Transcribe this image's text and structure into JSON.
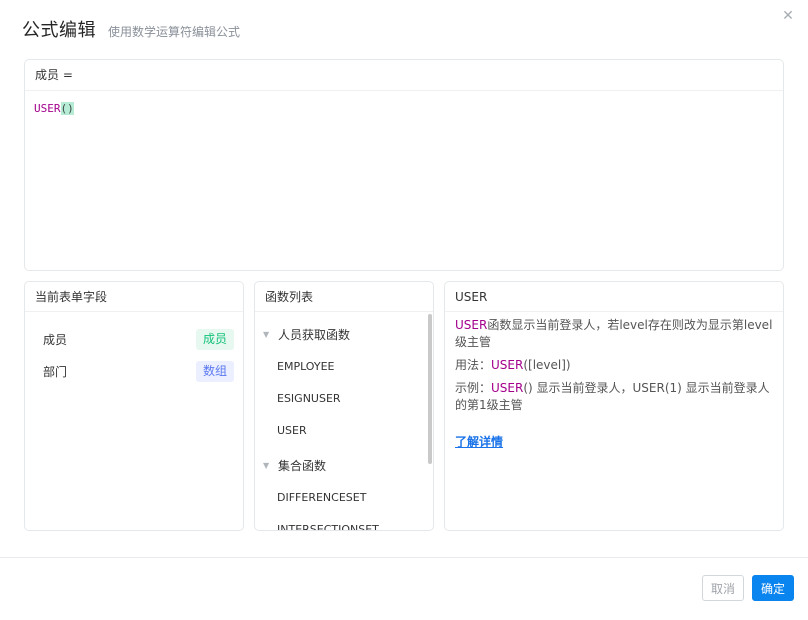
{
  "dialog": {
    "title": "公式编辑",
    "subtitle": "使用数学运算符编辑公式",
    "close_glyph": "✕"
  },
  "editor": {
    "field_label": "成员 =",
    "formula_fn": "USER",
    "formula_parens": "()"
  },
  "fields_panel": {
    "title": "当前表单字段",
    "items": [
      {
        "label": "成员",
        "type": "成员"
      },
      {
        "label": "部门",
        "type": "数组"
      }
    ]
  },
  "function_panel": {
    "title": "函数列表",
    "groups": [
      {
        "name": "人员获取函数",
        "items": [
          "EMPLOYEE",
          "ESIGNUSER",
          "USER"
        ]
      },
      {
        "name": "集合函数",
        "items": [
          "DIFFERENCESET",
          "INTERSECTIONSET"
        ]
      }
    ]
  },
  "detail_panel": {
    "title": "USER",
    "desc_fn": "USER",
    "desc_text": "函数显示当前登录人，若level存在则改为显示第level级主管",
    "usage_prefix": "用法：",
    "usage_fn": "USER",
    "usage_args": "([level])",
    "example_prefix": "示例：",
    "example_fn": "USER",
    "example_text": "() 显示当前登录人，USER(1) 显示当前登录人的第1级主管",
    "learn_more": "了解详情"
  },
  "footer": {
    "cancel": "取消",
    "ok": "确定"
  },
  "colors": {
    "function_highlight": "#a3008c",
    "primary": "#0a84ee",
    "tag_green": "#14c27a",
    "tag_blue": "#5a78f0"
  }
}
